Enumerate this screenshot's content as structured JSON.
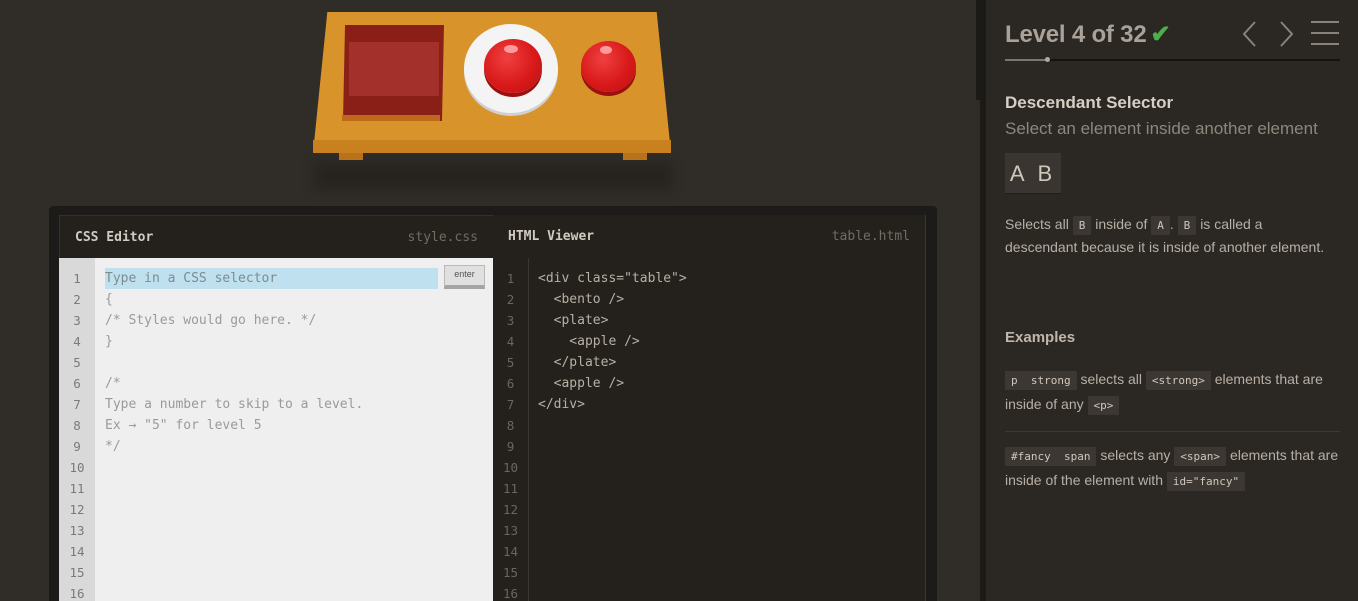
{
  "editor": {
    "css_title": "CSS Editor",
    "css_file": "style.css",
    "html_title": "HTML Viewer",
    "html_file": "table.html",
    "input_placeholder": "Type in a CSS selector",
    "enter_label": "enter",
    "line_numbers": [
      "1",
      "2",
      "3",
      "4",
      "5",
      "6",
      "7",
      "8",
      "9",
      "10",
      "11",
      "12",
      "13",
      "14",
      "15",
      "16"
    ],
    "css_lines": [
      "",
      "{",
      "/* Styles would go here. */",
      "}",
      "",
      "/*",
      "Type a number to skip to a level.",
      "Ex → \"5\" for level 5",
      "*/"
    ],
    "html_lines": [
      "<div class=\"table\">",
      "  <bento />",
      "  <plate>",
      "    <apple />",
      "  </plate>",
      "  <apple />",
      "</div>"
    ]
  },
  "sidebar": {
    "level_text": "Level 4 of 32",
    "progress": 0.125,
    "selector_name": "Descendant Selector",
    "selector_sub": "Select an element inside another element",
    "syntax": "A B",
    "desc_p1": "Selects all",
    "desc_tag_b": "B",
    "desc_p2": "inside of",
    "desc_tag_a": "A",
    "desc_dot": ".",
    "desc_tag_b2": "B",
    "desc_p3": "is called a descendant because it is inside of another element.",
    "examples_heading": "Examples",
    "ex1_code": "p  strong",
    "ex1_t1": "selects all",
    "ex1_tag": "<strong>",
    "ex1_t2": "elements that are inside of any",
    "ex1_tag2": "<p>",
    "ex2_code": "#fancy  span",
    "ex2_t1": "selects any",
    "ex2_tag": "<span>",
    "ex2_t2": "elements that are inside of the element with",
    "ex2_tag2": "id=\"fancy\""
  },
  "colors": {
    "accent_check": "#4cae4c",
    "apple_red": "#d9191a",
    "table": "#d9932b",
    "bento": "#8a1f18"
  },
  "icons": [
    "check-icon",
    "chevron-left-icon",
    "chevron-right-icon",
    "hamburger-menu-icon"
  ]
}
